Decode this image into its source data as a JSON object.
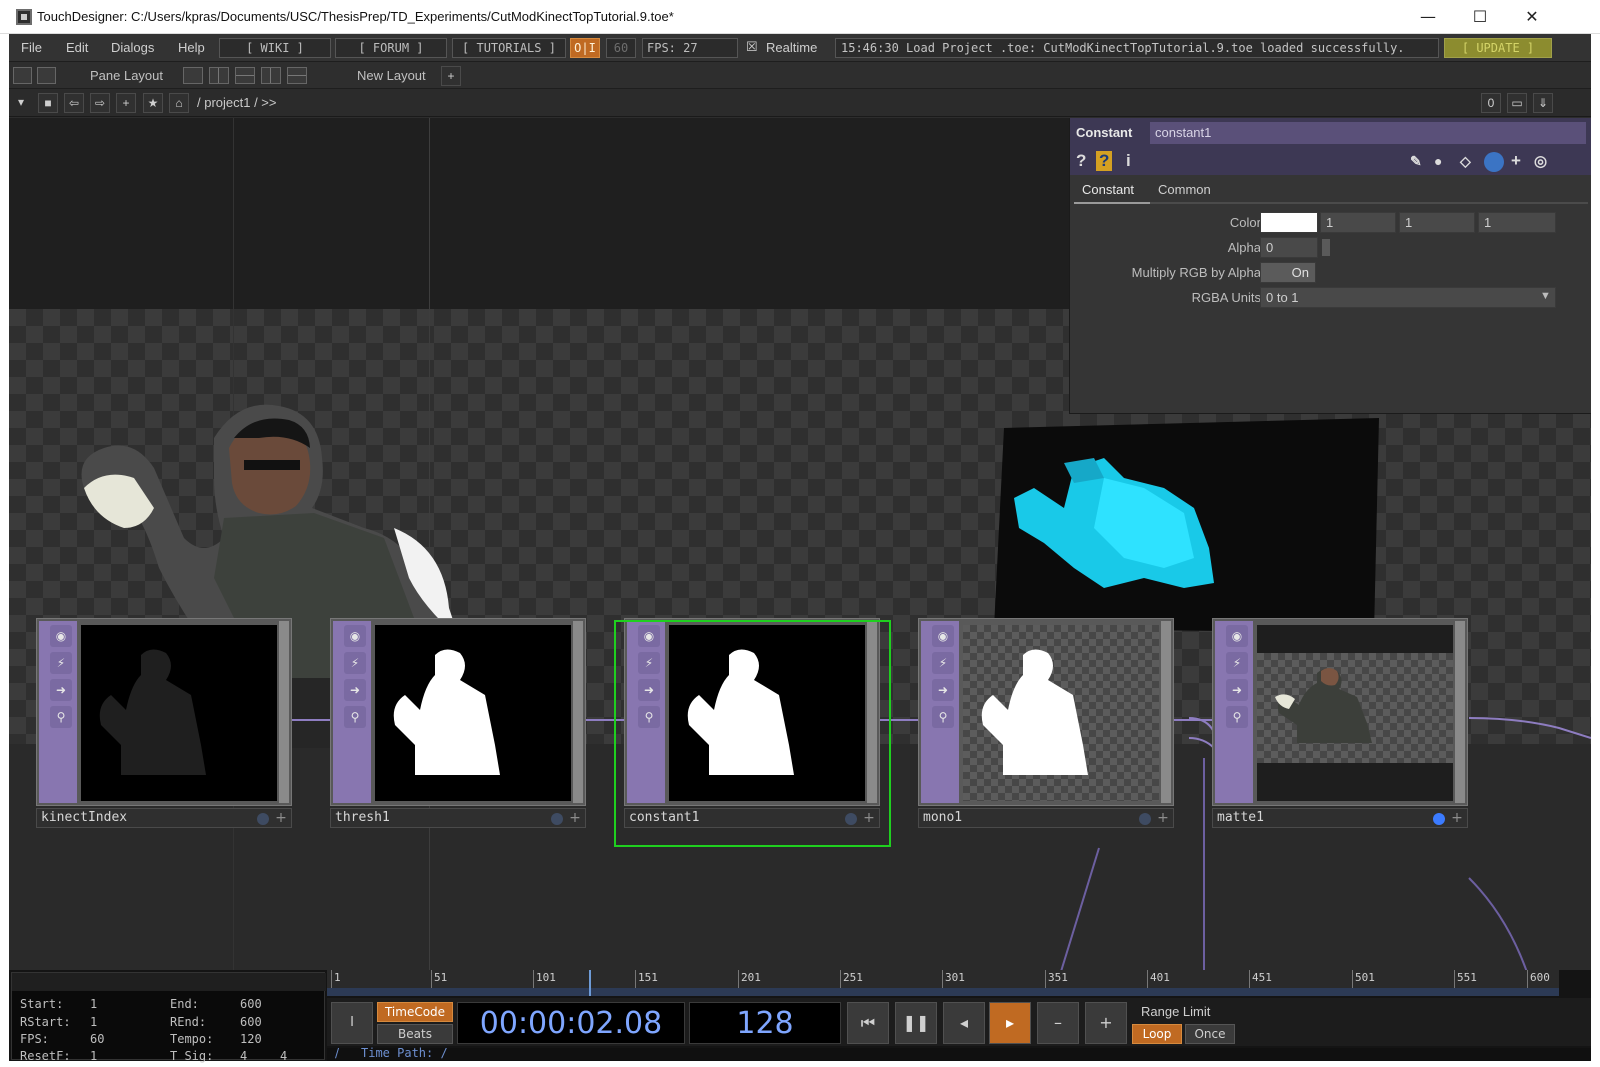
{
  "titlebar": {
    "title": "TouchDesigner: C:/Users/kpras/Documents/USC/ThesisPrep/TD_Experiments/CutModKinectTopTutorial.9.toe*",
    "minimize": "—",
    "maximize": "☐",
    "close": "✕"
  },
  "menu": {
    "file": "File",
    "edit": "Edit",
    "dialogs": "Dialogs",
    "help": "Help",
    "wiki": "[ WIKI ]",
    "forum": "[ FORUM ]",
    "tutorials": "[ TUTORIALS ]",
    "oi": "O|I",
    "fps_target": "60",
    "fps": "FPS: 27",
    "realtime_check": "☒",
    "realtime": "Realtime",
    "status": "15:46:30 Load Project .toe: CutModKinectTopTutorial.9.toe loaded successfully.",
    "update": "[ UPDATE ]"
  },
  "panebar": {
    "pane_layout": "Pane Layout",
    "new_layout": "New Layout",
    "new_layout_plus": "+"
  },
  "pathbar": {
    "dropdown": "▾",
    "stop": "■",
    "back": "⇦",
    "forward": "⇨",
    "add": "+",
    "star": "★",
    "home": "⌂",
    "path": "/ project1 / >>",
    "zero": "0",
    "window": "▭",
    "download": "⇓"
  },
  "param_panel": {
    "op_type": "Constant",
    "op_name": "constant1",
    "help_icon": "?",
    "python_help_icon": "?",
    "info_icon": "i",
    "tabs": [
      "Constant",
      "Common"
    ],
    "color_label": "Color",
    "color_values": [
      "1",
      "1",
      "1"
    ],
    "alpha_label": "Alpha",
    "alpha_value": "0",
    "multiply_label": "Multiply RGB by Alpha",
    "multiply_value": "On",
    "rgba_label": "RGBA Units",
    "rgba_value": "0 to 1"
  },
  "nodes": [
    {
      "name": "kinectIndex"
    },
    {
      "name": "thresh1"
    },
    {
      "name": "constant1"
    },
    {
      "name": "mono1"
    },
    {
      "name": "matte1"
    }
  ],
  "timeline": {
    "start_label": "Start:",
    "start": "1",
    "end_label": "End:",
    "end": "600",
    "rstart_label": "RStart:",
    "rstart": "1",
    "rend_label": "REnd:",
    "rend": "600",
    "fps_label": "FPS:",
    "fps": "60",
    "tempo_label": "Tempo:",
    "tempo": "120",
    "resetf_label": "ResetF:",
    "resetf": "1",
    "tsig_label": "T Sig:",
    "tsig_a": "4",
    "tsig_b": "4",
    "ticks": [
      "1",
      "51",
      "101",
      "151",
      "201",
      "251",
      "301",
      "351",
      "401",
      "451",
      "501",
      "551",
      "600"
    ],
    "i_button": "I",
    "timecode_label": "TimeCode",
    "beats_label": "Beats",
    "timecode": "00:00:02.08",
    "frame": "128",
    "range_limit": "Range Limit",
    "loop": "Loop",
    "once": "Once",
    "slash": "/",
    "time_path": "Time Path: /"
  }
}
